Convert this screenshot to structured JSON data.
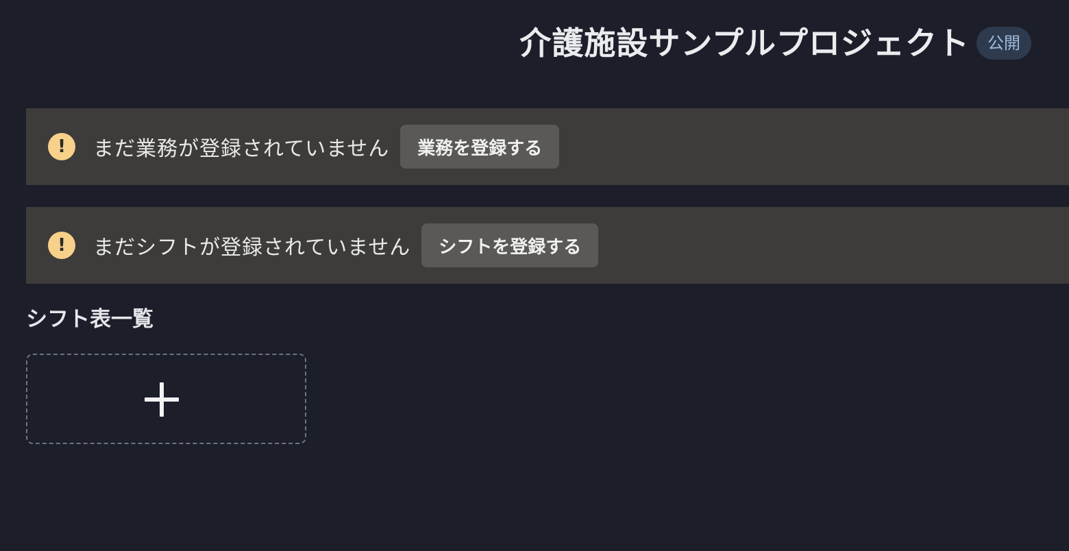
{
  "header": {
    "title": "介護施設サンプルプロジェクト",
    "visibility_badge": "公開"
  },
  "alerts": [
    {
      "icon": "warning-icon",
      "icon_symbol": "!",
      "message": "まだ業務が登録されていません",
      "button_label": "業務を登録する"
    },
    {
      "icon": "warning-icon",
      "icon_symbol": "!",
      "message": "まだシフトが登録されていません",
      "button_label": "シフトを登録する"
    }
  ],
  "shift_list": {
    "title": "シフト表一覧",
    "add_icon": "plus-icon"
  },
  "colors": {
    "background": "#1c1f2a",
    "alert_background": "#3d3c3a",
    "warning_icon": "#f7d08a",
    "badge_background": "#2e3a4d",
    "badge_text": "#9dbbe0",
    "button_background": "#5a5957"
  }
}
